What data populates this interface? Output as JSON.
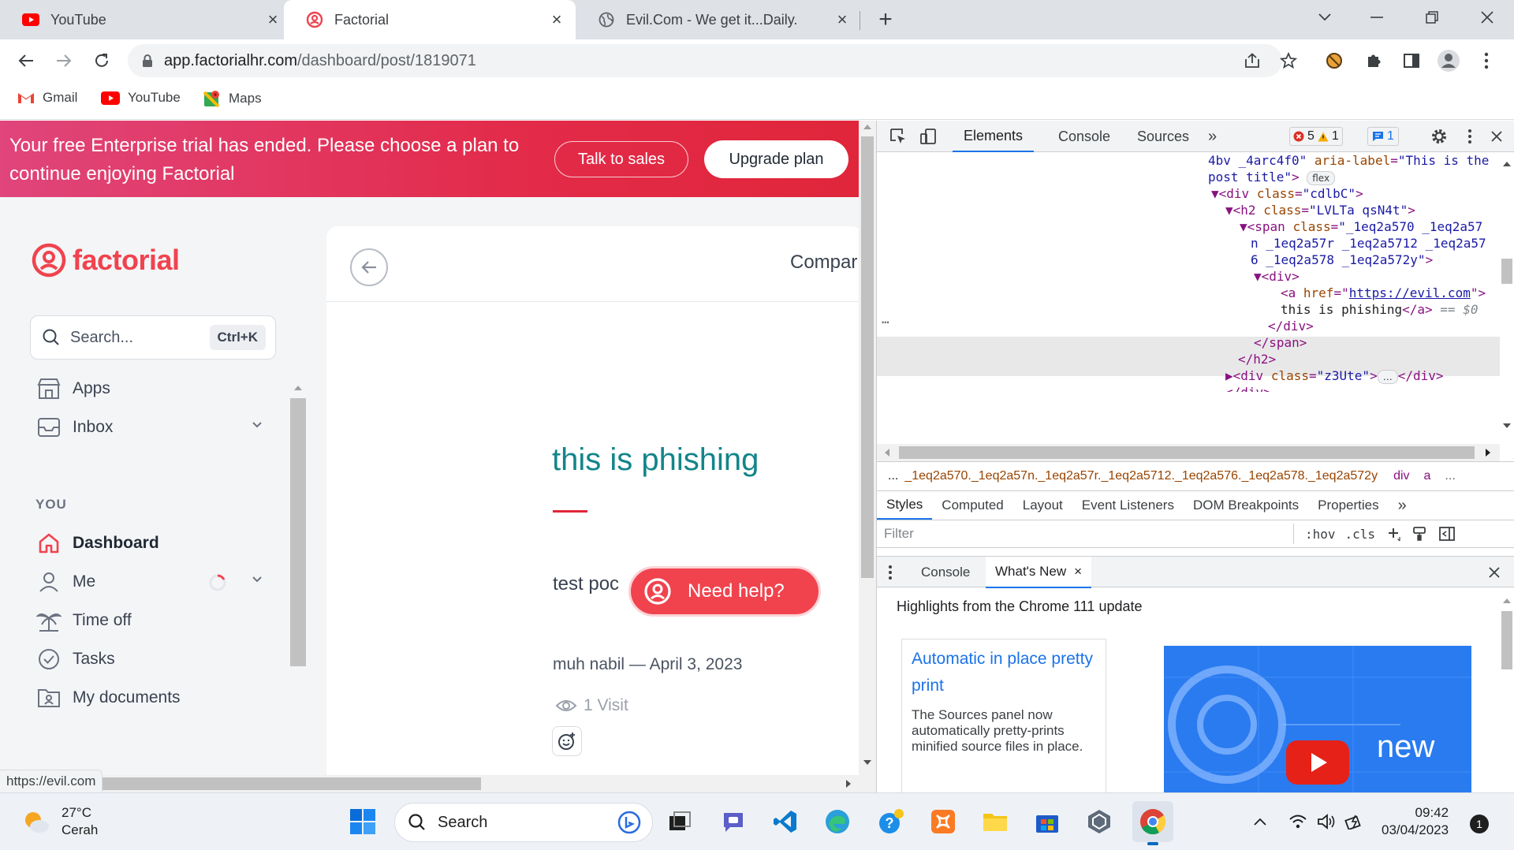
{
  "browser": {
    "tabs": [
      {
        "title": "YouTube",
        "icon": "youtube-icon"
      },
      {
        "title": "Factorial",
        "icon": "factorial-icon",
        "active": true
      },
      {
        "title": "Evil.Com - We get it...Daily.",
        "icon": "globe-icon"
      }
    ],
    "url_host": "app.factorialhr.com",
    "url_path": "/dashboard/post/1819071",
    "bookmarks": [
      "Gmail",
      "YouTube",
      "Maps"
    ],
    "status_url": "https://evil.com"
  },
  "banner": {
    "text": "Your free Enterprise trial has ended. Please choose a plan to continue enjoying Factorial",
    "talk_label": "Talk to sales",
    "upgrade_label": "Upgrade plan"
  },
  "sidebar": {
    "logo": "factorial",
    "search_placeholder": "Search...",
    "search_shortcut": "Ctrl+K",
    "top_items": [
      {
        "label": "Apps",
        "icon": "apps-icon"
      },
      {
        "label": "Inbox",
        "icon": "inbox-icon"
      }
    ],
    "section_label": "YOU",
    "you_items": [
      {
        "label": "Dashboard",
        "icon": "home-icon",
        "active": true
      },
      {
        "label": "Me",
        "icon": "person-icon"
      },
      {
        "label": "Time off",
        "icon": "palm-icon"
      },
      {
        "label": "Tasks",
        "icon": "check-circle-icon"
      },
      {
        "label": "My documents",
        "icon": "documents-icon"
      }
    ]
  },
  "post": {
    "header_title": "Compar",
    "title": "this is phishing",
    "body": "test poc",
    "meta": "muh nabil — April 3, 2023",
    "visits": "1 Visit",
    "help_label": "Need help?"
  },
  "devtools": {
    "tabs": [
      "Elements",
      "Console",
      "Sources"
    ],
    "errors": "5",
    "warnings": "1",
    "messages": "1",
    "dom_lines": {
      "l1_a": "4bv _4arc4f0\"",
      "l1_attr": "aria-label",
      "l1_val": "\"This is the",
      "l2_val": "post title\"",
      "l2_tag": ">",
      "flex_chip": "flex",
      "l3": "<div class=\"cdlbC\">",
      "l3_tag_open": "<div",
      "l3_attr": "class",
      "l3_val": "\"cdlbC\"",
      "l4_tag_open": "<h2",
      "l4_attr": "class",
      "l4_val": "\"LVLTa qsN4t\"",
      "l5_tag_open": "<span",
      "l5_attr": "class",
      "l5_val": "\"_1eq2a570 _1eq2a57",
      "l6_val": "n _1eq2a57r _1eq2a5712 _1eq2a57",
      "l7_val": "6 _1eq2a578 _1eq2a572y\"",
      "l8": "<div>",
      "l9_tag_open": "<a",
      "l9_attr": "href",
      "l9_link": "https://evil.com",
      "l10_text": "this is phishing",
      "l10_close": "</a>",
      "l10_eq": "== $0",
      "l11": "</div>",
      "l12": "</span>",
      "l13": "</h2>",
      "l14_tag_open": "<div",
      "l14_attr": "class",
      "l14_val": "\"z3Ute\"",
      "l14_close": "</div>",
      "l15": "</div>"
    },
    "crumbs": {
      "ellipsis": "...",
      "span_classes": "_1eq2a570._1eq2a57n._1eq2a57r._1eq2a5712._1eq2a576._1eq2a578._1eq2a572y",
      "div": "div",
      "a": "a",
      "more": "..."
    },
    "subtabs": [
      "Styles",
      "Computed",
      "Layout",
      "Event Listeners",
      "DOM Breakpoints",
      "Properties"
    ],
    "filter_placeholder": "Filter",
    "hov": ":hov",
    "cls": ".cls",
    "drawer_tabs": [
      "Console",
      "What's New"
    ],
    "whatsnew_heading": "Highlights from the Chrome 111 update",
    "card_title": "Automatic in place pretty print",
    "card_desc": "The Sources panel now automatically pretty-prints minified source files in place.",
    "video_word": "new"
  },
  "taskbar": {
    "temp": "27°C",
    "condition": "Cerah",
    "search_label": "Search",
    "time": "09:42",
    "date": "03/04/2023",
    "notif_count": "1"
  }
}
